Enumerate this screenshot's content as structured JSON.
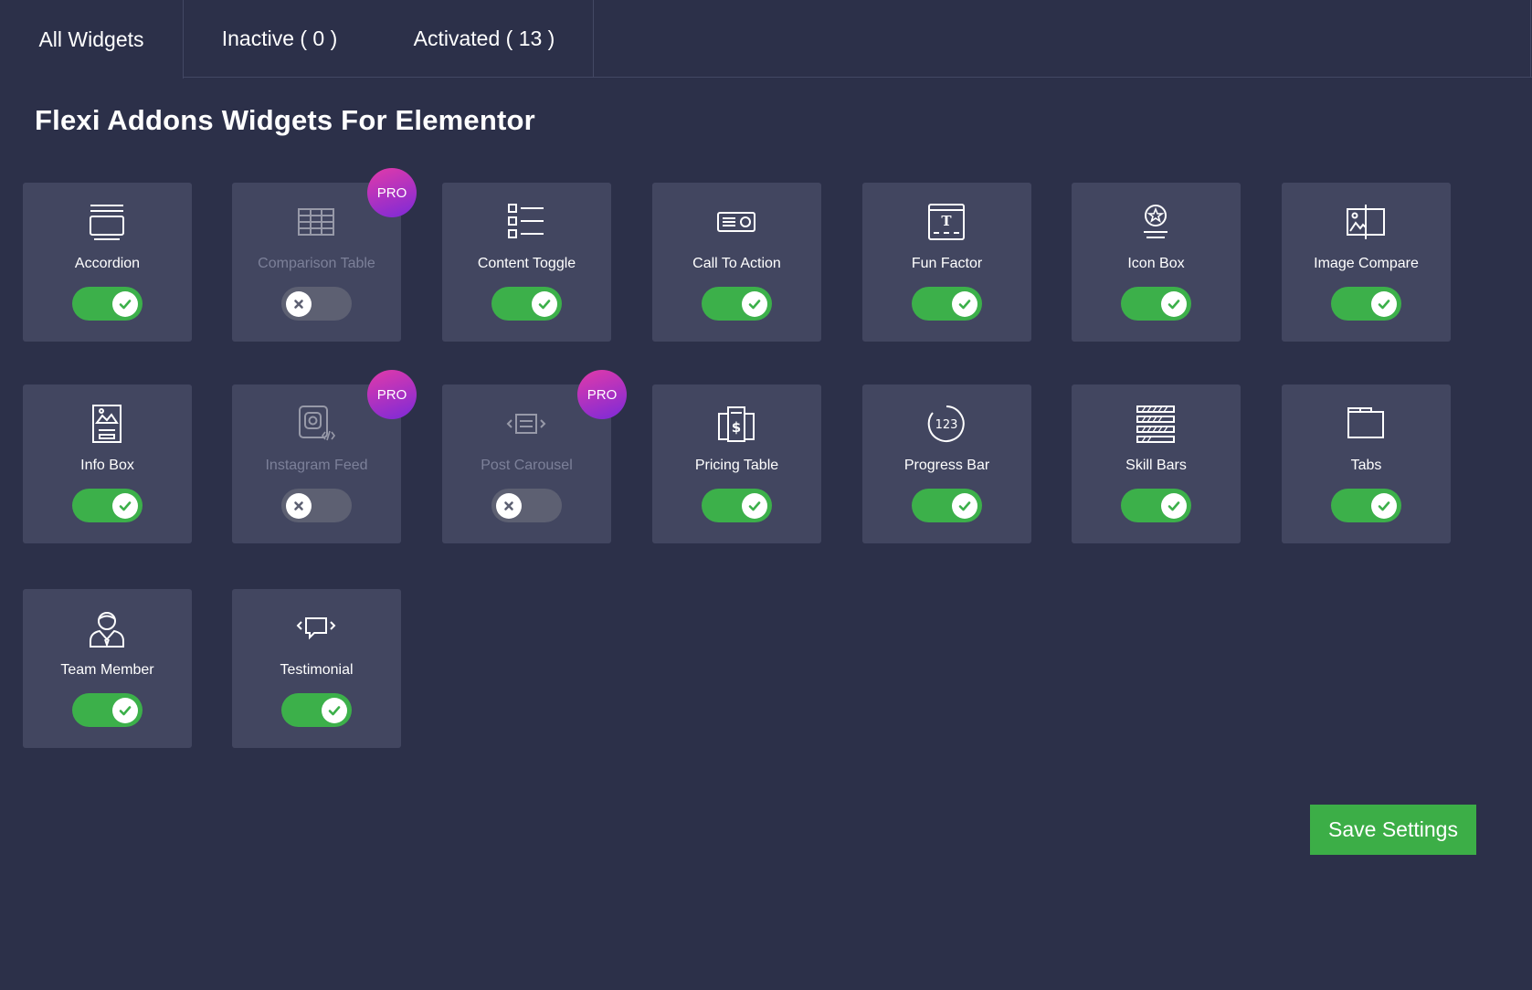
{
  "tabs": [
    {
      "label": "All Widgets"
    },
    {
      "label": "Inactive ( 0 )"
    },
    {
      "label": "Activated ( 13 )"
    }
  ],
  "page_title": "Flexi Addons Widgets For Elementor",
  "pro_label": "PRO",
  "widgets": [
    {
      "label": "Accordion",
      "icon": "accordion-icon",
      "enabled": true,
      "pro": false
    },
    {
      "label": "Comparison Table",
      "icon": "table-icon",
      "enabled": false,
      "pro": true
    },
    {
      "label": "Content Toggle",
      "icon": "list-toggle-icon",
      "enabled": true,
      "pro": false
    },
    {
      "label": "Call To Action",
      "icon": "call-to-action-icon",
      "enabled": true,
      "pro": false
    },
    {
      "label": "Fun Factor",
      "icon": "fun-factor-icon",
      "enabled": true,
      "pro": false
    },
    {
      "label": "Icon Box",
      "icon": "icon-box-icon",
      "enabled": true,
      "pro": false
    },
    {
      "label": "Image Compare",
      "icon": "image-compare-icon",
      "enabled": true,
      "pro": false
    },
    {
      "label": "Info Box",
      "icon": "info-box-icon",
      "enabled": true,
      "pro": false
    },
    {
      "label": "Instagram Feed",
      "icon": "instagram-feed-icon",
      "enabled": false,
      "pro": true
    },
    {
      "label": "Post Carousel",
      "icon": "post-carousel-icon",
      "enabled": false,
      "pro": true
    },
    {
      "label": "Pricing Table",
      "icon": "pricing-table-icon",
      "enabled": true,
      "pro": false
    },
    {
      "label": "Progress Bar",
      "icon": "progress-bar-icon",
      "enabled": true,
      "pro": false
    },
    {
      "label": "Skill Bars",
      "icon": "skill-bars-icon",
      "enabled": true,
      "pro": false
    },
    {
      "label": "Tabs",
      "icon": "tabs-icon",
      "enabled": true,
      "pro": false
    },
    {
      "label": "Team Member",
      "icon": "team-member-icon",
      "enabled": true,
      "pro": false
    },
    {
      "label": "Testimonial",
      "icon": "testimonial-icon",
      "enabled": true,
      "pro": false
    }
  ],
  "progress_icon_text": "123",
  "fun_factor_icon_text": "T",
  "save_button": "Save Settings",
  "colors": {
    "background": "#2c3049",
    "card": "#424660",
    "toggle_on": "#3cb04a",
    "toggle_off": "#5d6072",
    "save_button": "#3cae47",
    "pro_gradient_start": "#e23aa9",
    "pro_gradient_end": "#7b2ad8"
  }
}
